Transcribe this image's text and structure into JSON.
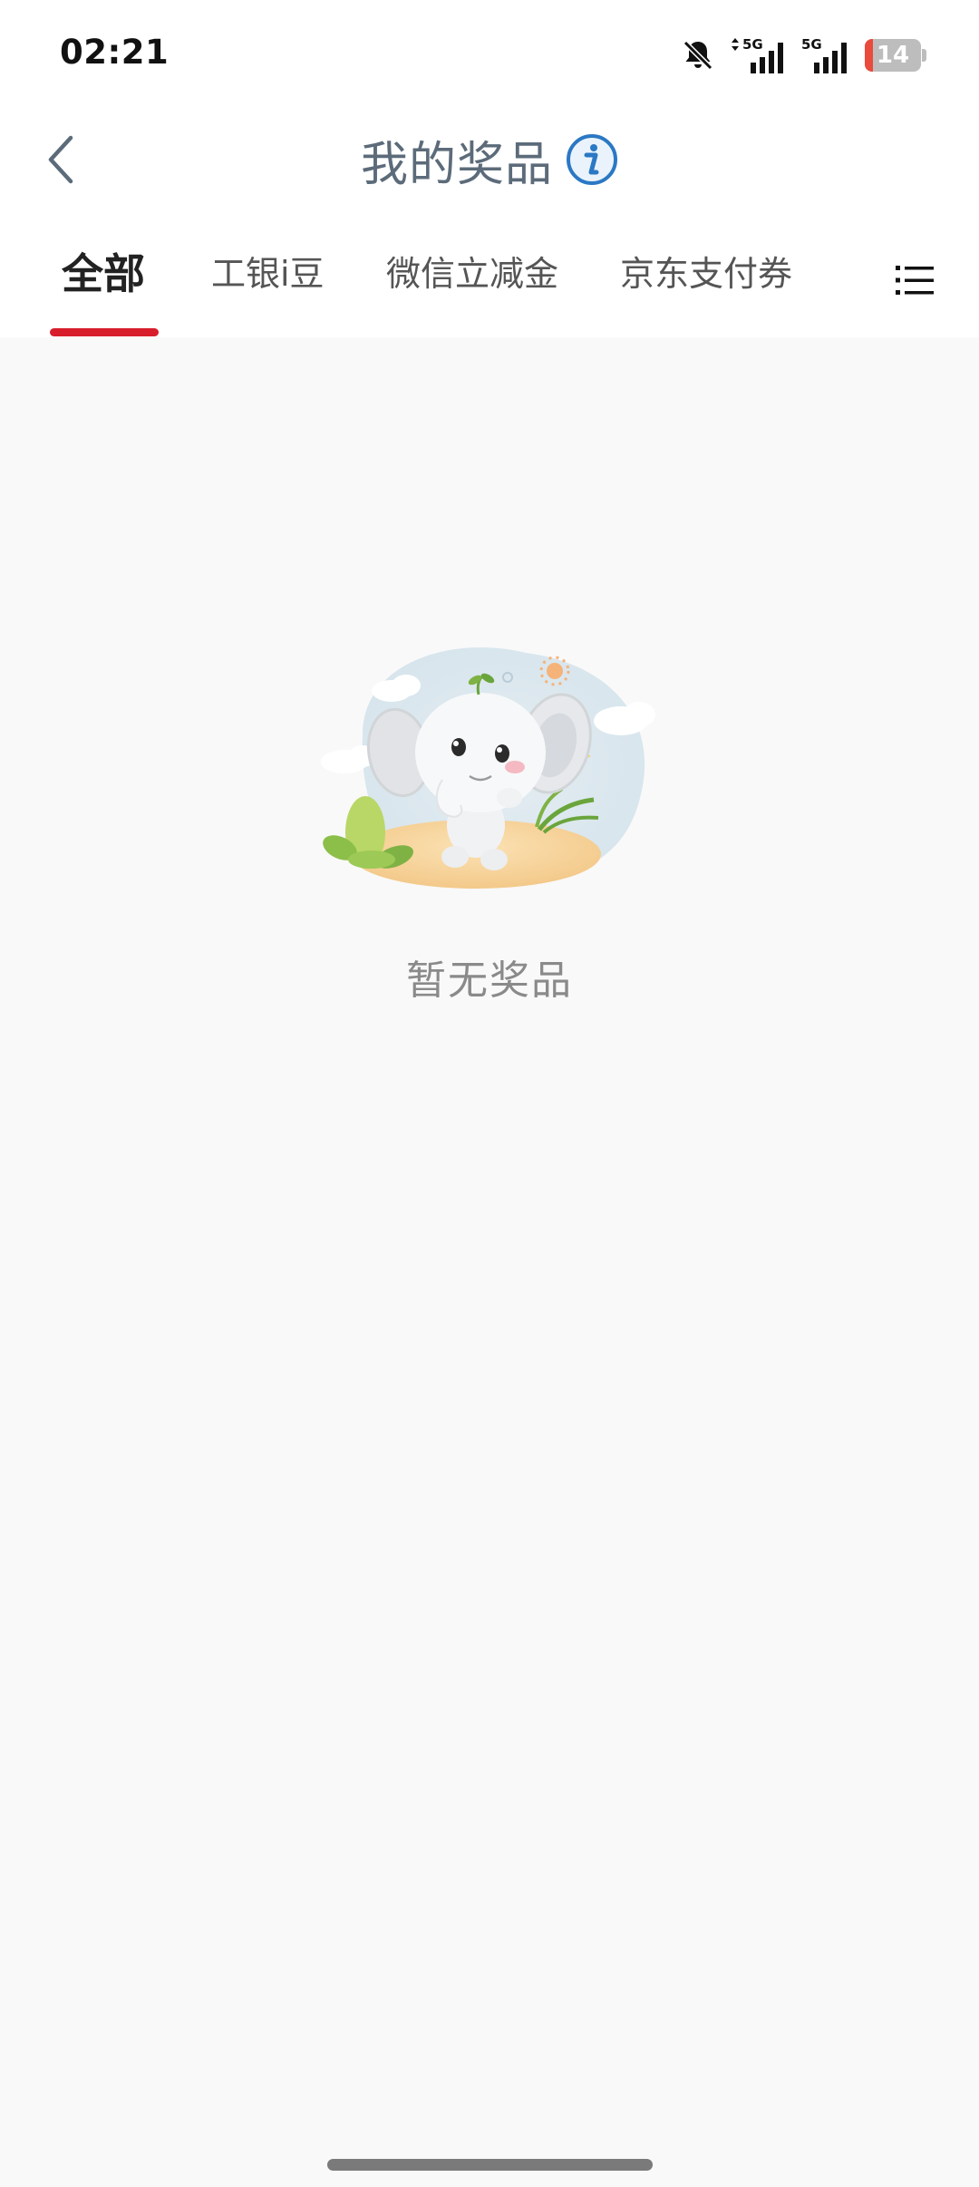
{
  "status_bar": {
    "time": "02:21",
    "network_1": "5G",
    "network_2": "5G",
    "battery_level": "14",
    "battery_color": "#e94b3c"
  },
  "nav": {
    "title": "我的奖品",
    "back_icon": "chevron-left-icon",
    "info_icon": "info-icon"
  },
  "tabs": {
    "items": [
      {
        "label": "全部",
        "active": true
      },
      {
        "label": "工银i豆",
        "active": false
      },
      {
        "label": "微信立减金",
        "active": false
      },
      {
        "label": "京东支付券",
        "active": false
      }
    ],
    "menu_icon": "list-menu-icon",
    "accent_color": "#d81e2c"
  },
  "empty_state": {
    "message": "暂无奖品",
    "illustration": "elephant-mascot-illustration"
  }
}
